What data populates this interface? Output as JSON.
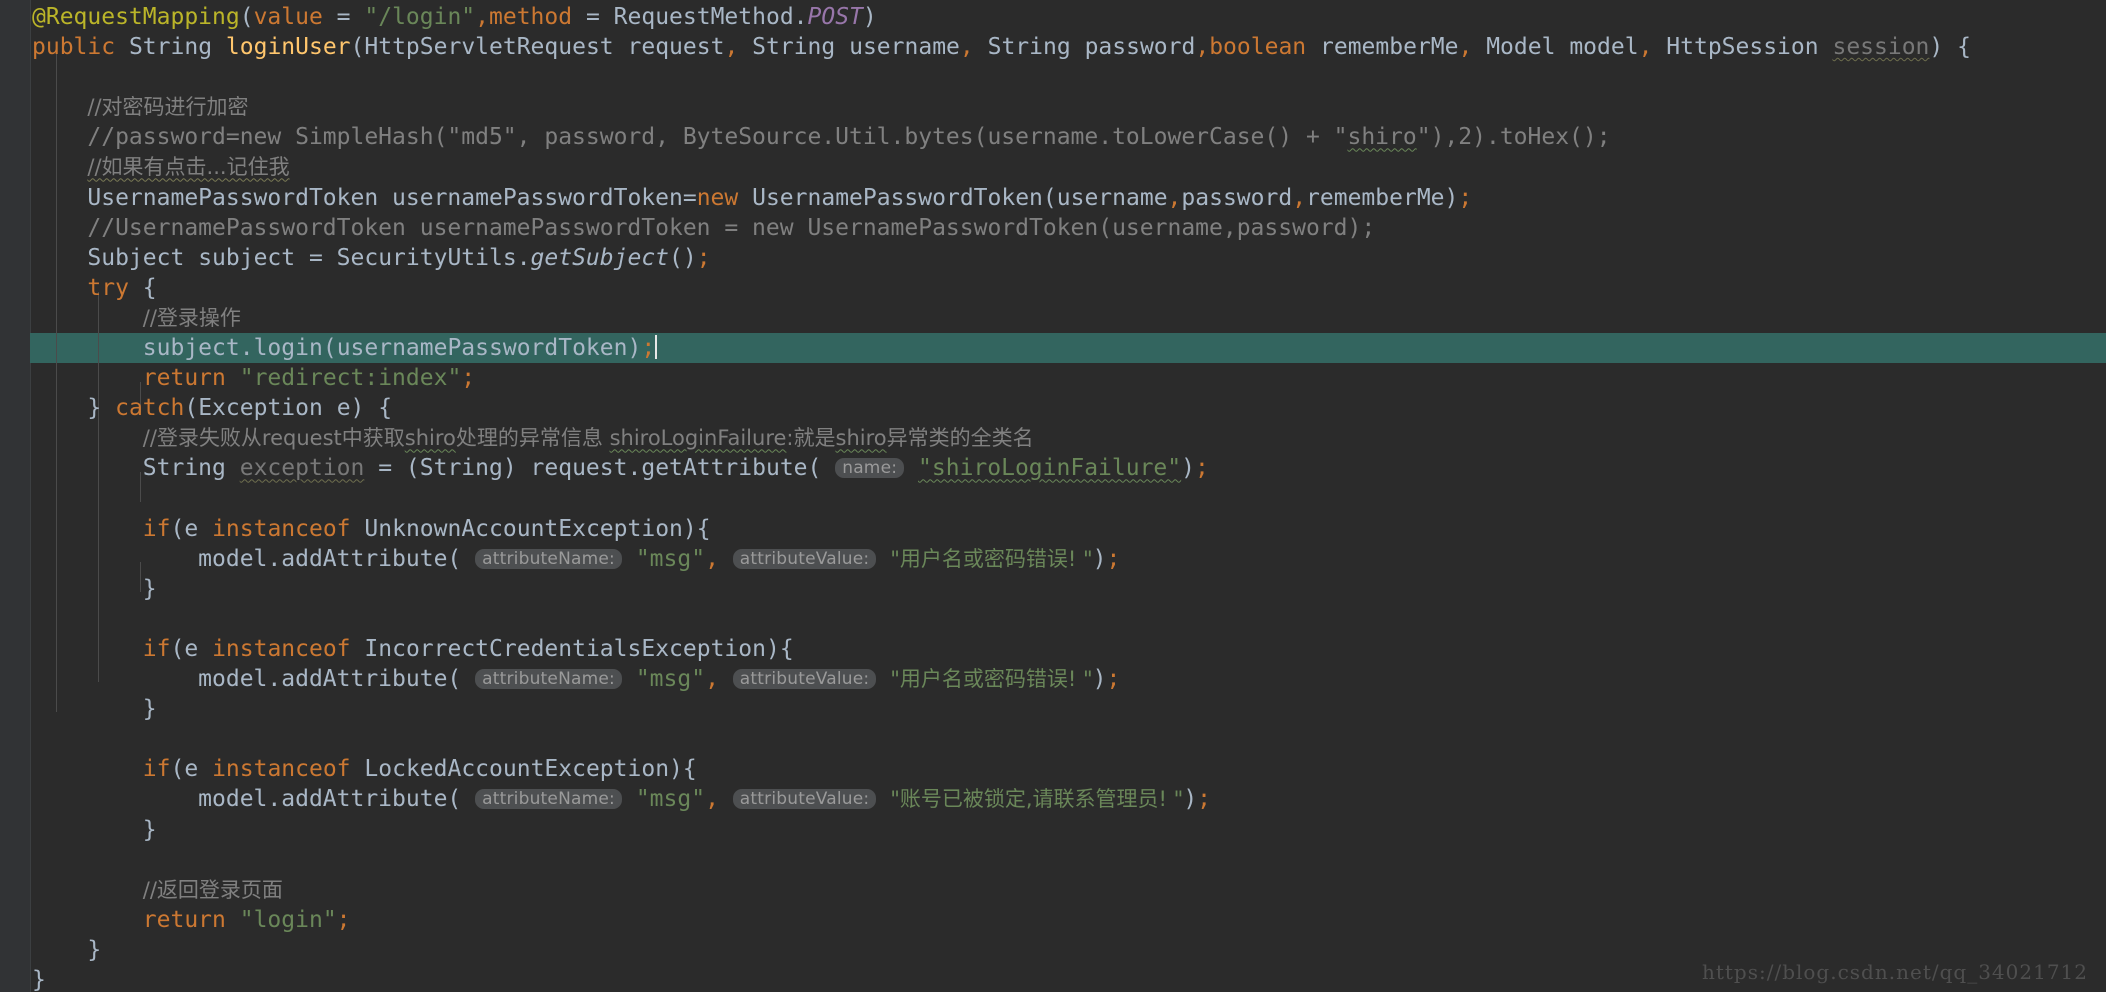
{
  "app": {
    "kind": "code-editor",
    "theme": "darcula",
    "language": "java"
  },
  "colors": {
    "background": "#2b2b2b",
    "gutter": "#313335",
    "selection": "#33655f",
    "default_text": "#a9b7c6",
    "keyword": "#cc7832",
    "string": "#6a8759",
    "comment": "#808080",
    "annotation": "#bbb529",
    "method": "#ffc66d",
    "static_field": "#9876aa",
    "number": "#6897bb",
    "inlay_hint_bg": "#4d4f51",
    "inlay_hint_text": "#9a9a9a",
    "caret": "#e8e8e8",
    "watermark": "#4f4f4f"
  },
  "watermark": {
    "text": "https://blog.csdn.net/qq_34021712"
  },
  "code": {
    "lines": [
      {
        "n": 1,
        "indent": 0,
        "text": "@RequestMapping(value = \"/login\",method = RequestMethod.POST)"
      },
      {
        "n": 2,
        "indent": 0,
        "text": "public String loginUser(HttpServletRequest request, String username, String password,boolean rememberMe, Model model, HttpSession session) {"
      },
      {
        "n": 3,
        "indent": 1,
        "text": ""
      },
      {
        "n": 4,
        "indent": 1,
        "text": "//对密码进行加密"
      },
      {
        "n": 5,
        "indent": 1,
        "text": "//password=new SimpleHash(\"md5\", password, ByteSource.Util.bytes(username.toLowerCase() + \"shiro\"),2).toHex();"
      },
      {
        "n": 6,
        "indent": 1,
        "text": "//如果有点击...记住我"
      },
      {
        "n": 7,
        "indent": 1,
        "text": "UsernamePasswordToken usernamePasswordToken=new UsernamePasswordToken(username,password,rememberMe);"
      },
      {
        "n": 8,
        "indent": 1,
        "text": "//UsernamePasswordToken usernamePasswordToken = new UsernamePasswordToken(username,password);"
      },
      {
        "n": 9,
        "indent": 1,
        "text": "Subject subject = SecurityUtils.getSubject();"
      },
      {
        "n": 10,
        "indent": 1,
        "text": "try {"
      },
      {
        "n": 11,
        "indent": 2,
        "text": "//登录操作"
      },
      {
        "n": 12,
        "indent": 2,
        "text": "subject.login(usernamePasswordToken);"
      },
      {
        "n": 13,
        "indent": 2,
        "text": "return \"redirect:index\";"
      },
      {
        "n": 14,
        "indent": 1,
        "text": "} catch(Exception e) {"
      },
      {
        "n": 15,
        "indent": 2,
        "text": "//登录失败从request中获取shiro处理的异常信息 shiroLoginFailure:就是shiro异常类的全类名"
      },
      {
        "n": 16,
        "indent": 2,
        "text": "String exception = (String) request.getAttribute( name: \"shiroLoginFailure\");"
      },
      {
        "n": 17,
        "indent": 2,
        "text": ""
      },
      {
        "n": 18,
        "indent": 2,
        "text": "if(e instanceof UnknownAccountException){"
      },
      {
        "n": 19,
        "indent": 3,
        "text": "model.addAttribute( attributeName: \"msg\", attributeValue: \"用户名或密码错误! \");"
      },
      {
        "n": 20,
        "indent": 2,
        "text": "}"
      },
      {
        "n": 21,
        "indent": 2,
        "text": ""
      },
      {
        "n": 22,
        "indent": 2,
        "text": "if(e instanceof IncorrectCredentialsException){"
      },
      {
        "n": 23,
        "indent": 3,
        "text": "model.addAttribute( attributeName: \"msg\", attributeValue: \"用户名或密码错误! \");"
      },
      {
        "n": 24,
        "indent": 2,
        "text": "}"
      },
      {
        "n": 25,
        "indent": 2,
        "text": ""
      },
      {
        "n": 26,
        "indent": 2,
        "text": "if(e instanceof LockedAccountException){"
      },
      {
        "n": 27,
        "indent": 3,
        "text": "model.addAttribute( attributeName: \"msg\", attributeValue: \"账号已被锁定,请联系管理员! \");"
      },
      {
        "n": 28,
        "indent": 2,
        "text": "}"
      },
      {
        "n": 29,
        "indent": 2,
        "text": ""
      },
      {
        "n": 30,
        "indent": 2,
        "text": "//返回登录页面"
      },
      {
        "n": 31,
        "indent": 2,
        "text": "return \"login\";"
      },
      {
        "n": 32,
        "indent": 1,
        "text": "}"
      },
      {
        "n": 33,
        "indent": 0,
        "text": "}"
      }
    ],
    "selected_line": 12,
    "caret_line": 12,
    "caret_column": 38
  },
  "tokens": {
    "annotation_request_mapping": "@RequestMapping",
    "kw_value": "value",
    "str_login_path": "\"/login\"",
    "kw_method": "method",
    "type_request_method": "RequestMethod",
    "field_post": "POST",
    "kw_public": "public",
    "type_string": "String",
    "method_login_user": "loginUser",
    "type_http_servlet_request": "HttpServletRequest",
    "param_request": "request",
    "param_username": "username",
    "param_password": "password",
    "kw_boolean": "boolean",
    "param_remember_me": "rememberMe",
    "type_model": "Model",
    "param_model": "model",
    "type_http_session": "HttpSession",
    "param_session": "session",
    "comment_encrypt": "//对密码进行加密",
    "comment_simplehash": "//password=new SimpleHash(\"md5\", password, ByteSource.Util.bytes(username.toLowerCase() + \"shiro\"),2).toHex();",
    "comment_remember": "//如果有点击...记住我",
    "type_upt": "UsernamePasswordToken",
    "var_upt": "usernamePasswordToken",
    "kw_new": "new",
    "comment_upt_alt": "//UsernamePasswordToken usernamePasswordToken = new UsernamePasswordToken(username,password);",
    "type_subject": "Subject",
    "var_subject": "subject",
    "type_security_utils": "SecurityUtils",
    "method_get_subject": "getSubject",
    "kw_try": "try",
    "comment_login_op": "//登录操作",
    "call_subject_login": "subject.login(usernamePasswordToken);",
    "kw_return": "return",
    "str_redirect_index": "\"redirect:index\"",
    "kw_catch": "catch",
    "type_exception": "Exception",
    "var_e": "e",
    "comment_shiro_failure": "//登录失败从request中获取shiro处理的异常信息 shiroLoginFailure:就是shiro异常类的全类名",
    "var_exception_unused": "exception",
    "method_get_attribute": "getAttribute",
    "hint_name": "name:",
    "str_shiro_login_failure": "\"shiroLoginFailure\"",
    "kw_if": "if",
    "kw_instanceof": "instanceof",
    "type_unknown_account": "UnknownAccountException",
    "type_incorrect_credentials": "IncorrectCredentialsException",
    "type_locked_account": "LockedAccountException",
    "method_add_attribute": "model.addAttribute",
    "hint_attribute_name": "attributeName:",
    "hint_attribute_value": "attributeValue:",
    "str_msg": "\"msg\"",
    "str_user_or_pass_error": "\"用户名或密码错误! \"",
    "str_account_locked": "\"账号已被锁定,请联系管理员! \"",
    "comment_return_login_page": "//返回登录页面",
    "str_login": "\"login\""
  }
}
